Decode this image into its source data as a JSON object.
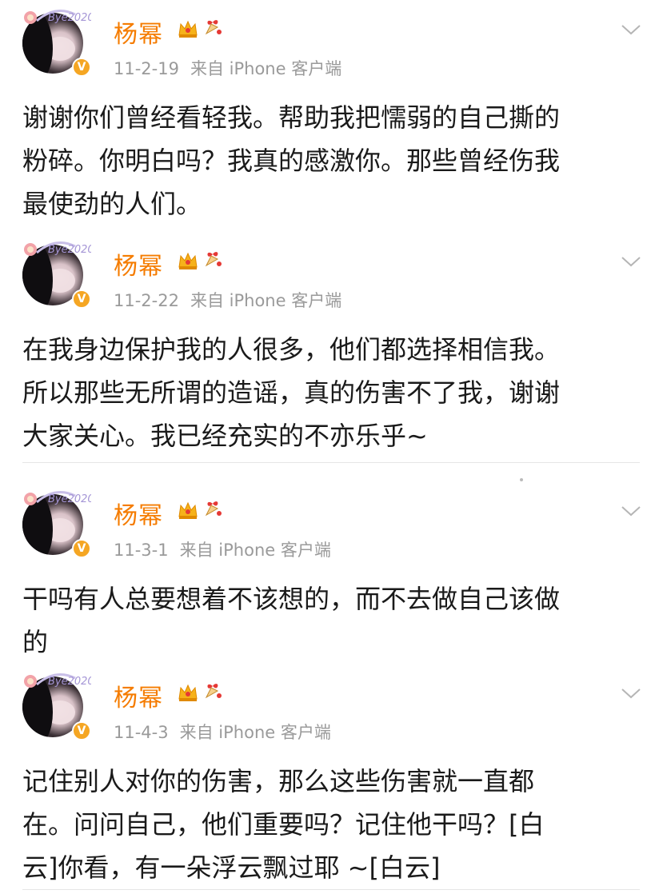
{
  "posts": [
    {
      "username": "杨幂",
      "time": "11-2-19",
      "source": "来自 iPhone 客户端",
      "lines": [
        "谢谢你们曾经看轻我。帮助我把懦弱的自己撕的",
        "粉碎。你明白吗？我真的感激你。那些曾经伤我",
        "最使劲的人们。"
      ]
    },
    {
      "username": "杨幂",
      "time": "11-2-22",
      "source": "来自 iPhone 客户端",
      "lines": [
        "在我身边保护我的人很多，他们都选择相信我。",
        "所以那些无所谓的造谣，真的伤害不了我，谢谢",
        "大家关心。我已经充实的不亦乐乎~"
      ]
    },
    {
      "username": "杨幂",
      "time": "11-3-1",
      "source": "来自 iPhone 客户端",
      "lines": [
        "干吗有人总要想着不该想的，而不去做自己该做",
        "的"
      ]
    },
    {
      "username": "杨幂",
      "time": "11-4-3",
      "source": "来自 iPhone 客户端",
      "lines": [
        "记住别人对你的伤害，那么这些伤害就一直都",
        "在。问问自己，他们重要吗？记住他干吗？[白",
        "云]你看，有一朵浮云飘过耶 ~[白云]"
      ]
    }
  ],
  "icons": {
    "verified": "verified-badge-icon",
    "crown": "crown-icon",
    "decoration": "bell-decoration-icon",
    "more": "chevron-down-icon"
  },
  "colors": {
    "username": "#f57c00",
    "meta": "#9a9a9a",
    "text": "#1a1a1a",
    "badge": "#f5a623"
  }
}
